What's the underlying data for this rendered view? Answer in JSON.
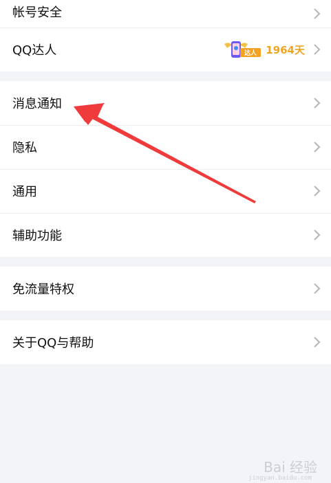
{
  "groups": [
    {
      "items": [
        {
          "label": "帐号安全"
        },
        {
          "label": "QQ达人",
          "badge": {
            "tag": "达人",
            "days": "1964天"
          }
        }
      ]
    },
    {
      "items": [
        {
          "label": "消息通知"
        },
        {
          "label": "隐私"
        },
        {
          "label": "通用"
        },
        {
          "label": "辅助功能"
        }
      ]
    },
    {
      "items": [
        {
          "label": "免流量特权"
        }
      ]
    },
    {
      "items": [
        {
          "label": "关于QQ与帮助"
        }
      ]
    }
  ],
  "annotation": {
    "arrow_color": "#ef3b3b"
  },
  "watermark": {
    "text": "Bai 经验",
    "sub": "jingyan.baidu.com"
  },
  "colors": {
    "background": "#f3f4f8",
    "row_bg": "#ffffff",
    "badge_gold": "#f0a522"
  }
}
